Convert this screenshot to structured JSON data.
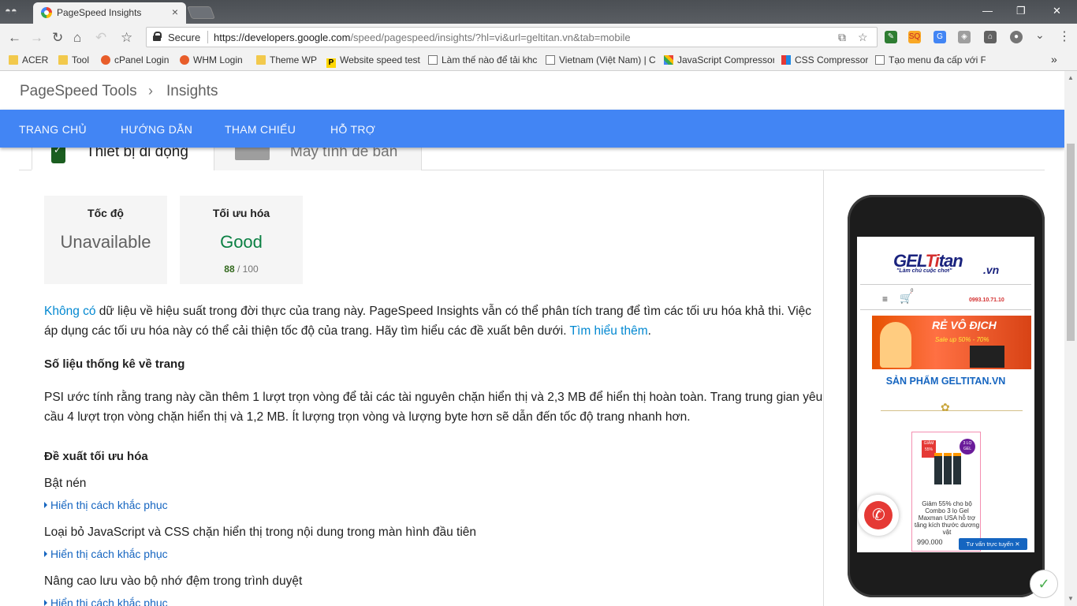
{
  "browser": {
    "tab_title": "PageSpeed Insights",
    "tab_close": "×",
    "url_host": "https://developers.google.com",
    "url_path": "/speed/pagespeed/insights/?hl=vi&url=geltitan.vn&tab=mobile",
    "secure_label": "Secure",
    "window_minimize": "—",
    "window_maximize": "❐",
    "window_close": "✕"
  },
  "bookmarks": [
    {
      "label": "ACER",
      "icon": "folder-icon"
    },
    {
      "label": "Tool",
      "icon": "folder-icon"
    },
    {
      "label": "cPanel Login",
      "icon": "cpanel-icon"
    },
    {
      "label": "WHM Login",
      "icon": "cpanel-icon"
    },
    {
      "label": "Theme WP",
      "icon": "folder-icon"
    },
    {
      "label": "Website speed test",
      "icon": "psi-icon"
    },
    {
      "label": "Làm thế nào để tải khc",
      "icon": "page-icon"
    },
    {
      "label": "Vietnam (Việt Nam) | C",
      "icon": "page-icon"
    },
    {
      "label": "JavaScript Compressor",
      "icon": "js-icon"
    },
    {
      "label": "CSS Compressor",
      "icon": "css-icon"
    },
    {
      "label": "Tạo menu đa cấp với F",
      "icon": "page-icon"
    }
  ],
  "header": {
    "crumb_tools": "PageSpeed Tools",
    "crumb_sep": "›",
    "crumb_insights": "Insights"
  },
  "nav": {
    "home": "TRANG CHỦ",
    "guide": "HƯỚNG DẪN",
    "reference": "THAM CHIẾU",
    "support": "HỖ TRỢ"
  },
  "device_tabs": {
    "mobile": "Thiết bị di động",
    "desktop": "Máy tính để bàn"
  },
  "scores": {
    "speed_title": "Tốc độ",
    "speed_value": "Unavailable",
    "opt_title": "Tối ưu hóa",
    "opt_value": "Good",
    "opt_score": "88",
    "opt_max": "/ 100",
    "good_color": "#0b8043"
  },
  "content": {
    "no_data_link": "Không có",
    "intro": " dữ liệu về hiệu suất trong đời thực của trang này. PageSpeed Insights vẫn có thể phân tích trang để tìm các tối ưu hóa khả thi. Việc áp dụng các tối ưu hóa này có thể cải thiện tốc độ của trang. Hãy tìm hiểu các đề xuất bên dưới. ",
    "learn_more": "Tìm hiểu thêm",
    "period": ".",
    "stats_heading": "Số liệu thống kê về trang",
    "stats_text": "PSI ước tính rằng trang này cần thêm 1 lượt trọn vòng để tải các tài nguyên chặn hiển thị và 2,3 MB để hiển thị hoàn toàn. Trang trung gian yêu cầu 4 lượt trọn vòng chặn hiển thị và 1,2 MB. Ít lượng trọn vòng và lượng byte hơn sẽ dẫn đến tốc độ trang nhanh hơn.",
    "suggest_heading": "Đề xuất tối ưu hóa",
    "rules": [
      {
        "title": "Bật nén",
        "fix": "Hiển thị cách khắc phục"
      },
      {
        "title": "Loại bỏ JavaScript và CSS chặn hiển thị trong nội dung trong màn hình đầu tiên",
        "fix": "Hiển thị cách khắc phục"
      },
      {
        "title": "Nâng cao lưu vào bộ nhớ đệm trong trình duyệt",
        "fix": "Hiển thị cách khắc phục"
      }
    ]
  },
  "preview": {
    "logo_a": "GEL",
    "logo_b": "Ti",
    "logo_c": "tan",
    "logo_vn": ".vn",
    "slogan": "\"Làm chủ cuộc chơi\"",
    "hotline": "0993.10.71.10",
    "cart_count": "0",
    "banner_title": "RẺ VÔ ĐỊCH",
    "banner_sale": "Sale up 50% - 70%",
    "products_heading": "SẢN PHẨM GELTITAN.VN",
    "badge_text": "GIẢM 55%",
    "badge2_text": "3 LỌ GEL",
    "product_desc": "Giảm 55% cho bộ Combo 3 lọ Gel Maxman USA hỗ trợ tăng kích thước dương vật",
    "product_price": "990.000",
    "chat_label": "Tư vấn trực tuyến ✕"
  }
}
